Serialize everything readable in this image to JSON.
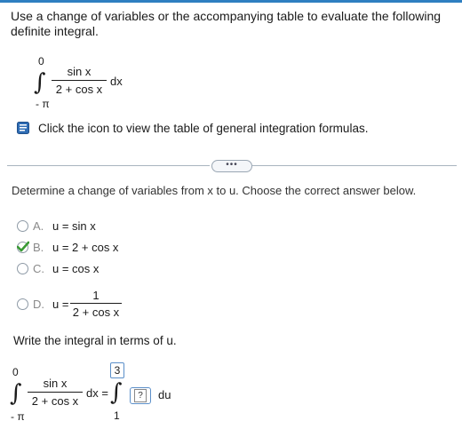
{
  "question": {
    "text": "Use a change of variables or the accompanying table to evaluate the following definite integral."
  },
  "integral": {
    "upper": "0",
    "lower": "- π",
    "numerator": "sin x",
    "denominator": "2 + cos x",
    "differential": "dx"
  },
  "hint": {
    "text": "Click the icon to view the table of general integration formulas."
  },
  "divider": {
    "button_label": "•••"
  },
  "part1": {
    "instruction": "Determine a change of variables from x to u. Choose the correct answer below.",
    "options": [
      {
        "letter": "A.",
        "value": "u = sin x",
        "selected": false
      },
      {
        "letter": "B.",
        "value": "u = 2 + cos x",
        "selected": true
      },
      {
        "letter": "C.",
        "value": "u = cos x",
        "selected": false
      },
      {
        "letter": "D.",
        "prefix": "u =",
        "numerator": "1",
        "denominator": "2 + cos x",
        "selected": false
      }
    ]
  },
  "part2": {
    "instruction": "Write the integral in terms of u.",
    "left": {
      "upper": "0",
      "lower": "- π",
      "numerator": "sin x",
      "denominator": "2 + cos x",
      "differential": "dx ="
    },
    "right": {
      "upper": "3",
      "lower": "1",
      "integrand_placeholder": "?",
      "differential": "du"
    }
  },
  "colors": {
    "accent": "#2f7fc1",
    "check_green": "#3a9a35",
    "radio_border": "#8e9aa6"
  }
}
